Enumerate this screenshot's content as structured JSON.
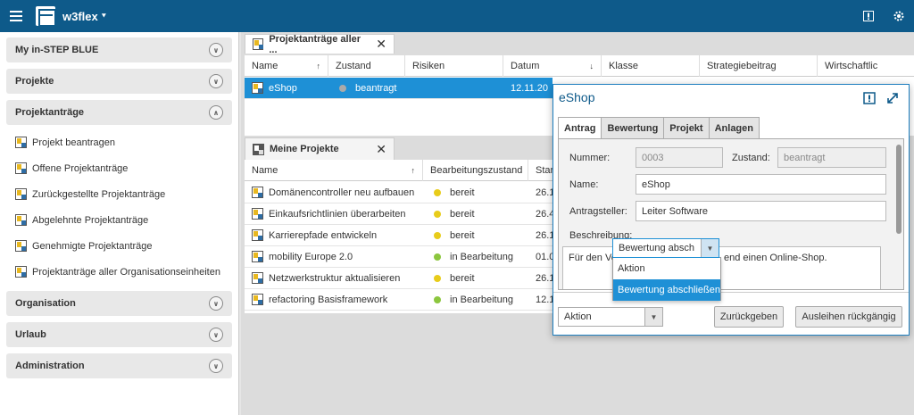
{
  "app": {
    "title": "w3flex"
  },
  "sidebar": {
    "sections": [
      {
        "label": "My in-STEP BLUE",
        "expanded": false
      },
      {
        "label": "Projekte",
        "expanded": false
      },
      {
        "label": "Projektanträge",
        "expanded": true,
        "items": [
          "Projekt beantragen",
          "Offene Projektanträge",
          "Zurückgestellte Projektanträge",
          "Abgelehnte Projektanträge",
          "Genehmigte Projektanträge",
          "Projektanträge aller Organisationseinheiten"
        ]
      },
      {
        "label": "Organisation",
        "expanded": false
      },
      {
        "label": "Urlaub",
        "expanded": false
      },
      {
        "label": "Administration",
        "expanded": false
      }
    ]
  },
  "panel_top": {
    "tab": "Projektanträge aller ...",
    "columns": [
      "Name",
      "Zustand",
      "Risiken",
      "Datum",
      "Klasse",
      "Strategiebeitrag",
      "Wirtschaftlic"
    ],
    "rows": [
      {
        "name": "eShop",
        "zustand": "beantragt",
        "datum": "12.11.20"
      }
    ]
  },
  "panel_bottom": {
    "tab": "Meine Projekte",
    "columns": [
      "Name",
      "Bearbeitungszustand",
      "Star"
    ],
    "rows": [
      {
        "name": "Domänencontroller neu aufbauen",
        "status": "bereit",
        "date": "26.1"
      },
      {
        "name": "Einkaufsrichtlinien überarbeiten",
        "status": "bereit",
        "date": "26.4"
      },
      {
        "name": "Karrierepfade entwickeln",
        "status": "bereit",
        "date": "26.1"
      },
      {
        "name": "mobility Europe 2.0",
        "status": "in Bearbeitung",
        "date": "01.0"
      },
      {
        "name": "Netzwerkstruktur aktualisieren",
        "status": "bereit",
        "date": "26.1"
      },
      {
        "name": "refactoring Basisframework",
        "status": "in Bearbeitung",
        "date": "12.1"
      }
    ]
  },
  "dialog": {
    "title": "eShop",
    "tabs": [
      "Antrag",
      "Bewertung",
      "Projekt",
      "Anlagen"
    ],
    "fields": {
      "nummer_label": "Nummer:",
      "nummer_value": "0003",
      "zustand_label": "Zustand:",
      "zustand_value": "beantragt",
      "name_label": "Name:",
      "name_value": "eShop",
      "antragsteller_label": "Antragsteller:",
      "antragsteller_value": "Leiter Software",
      "beschreibung_label": "Beschreibung:",
      "beschreibung_left": "Für den Ve",
      "beschreibung_right": "end einen Online-Shop."
    },
    "combo_value": "Bewertung absch",
    "dropdown": [
      "Aktion",
      "Bewertung abschließen"
    ],
    "action_combo": "Aktion",
    "btn_back": "Zurückgeben",
    "btn_undo": "Ausleihen rückgängig"
  },
  "colors": {
    "topbar": "#0e5a8a",
    "selection": "#1e90d6",
    "status_yellow": "#e8cc1a",
    "status_green": "#8cc63e",
    "status_grey": "#aaaaaa"
  }
}
